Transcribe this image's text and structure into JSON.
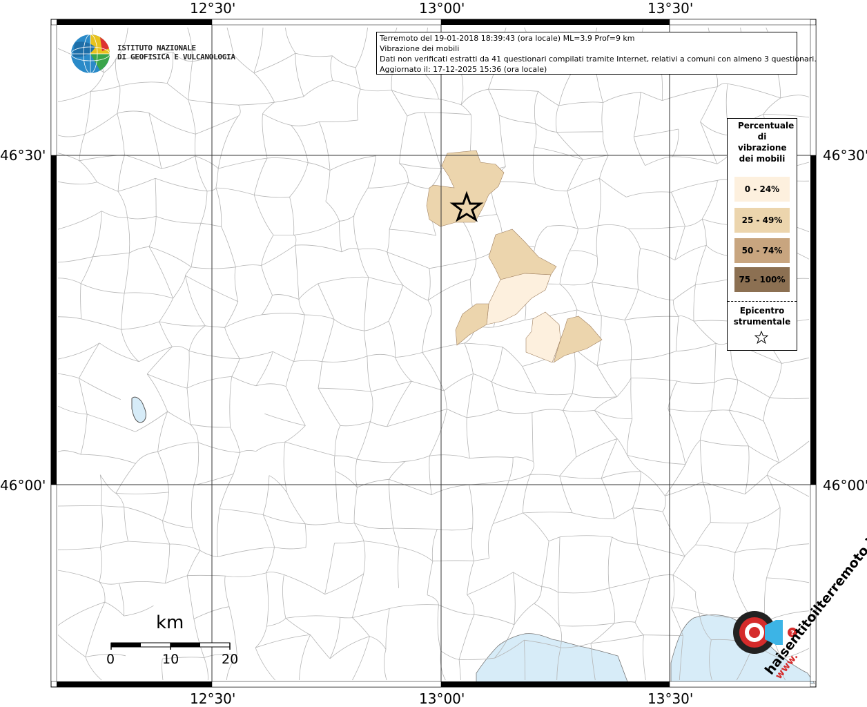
{
  "map": {
    "lon_labels": [
      "12°30'",
      "13°00'",
      "13°30'"
    ],
    "lat_labels": [
      "46°30'",
      "46°00'"
    ],
    "colors": {
      "class_0_24": "#fdf0de",
      "class_25_49": "#ecd5ad",
      "class_50_74": "#c8a57f",
      "class_75_100": "#8c7052",
      "water": "#d7ecf8",
      "border": "#aaaaaa"
    }
  },
  "info": {
    "line1": "Terremoto del 19-01-2018 18:39:43 (ora locale) ML=3.9 Prof=9 km",
    "line2": "Vibrazione dei mobili",
    "line3": "Dati non verificati estratti da 41 questionari compilati tramite Internet, relativi a comuni con almeno 3 questionari.",
    "line4": "Aggiornato il: 17-12-2025 15:36 (ora locale)"
  },
  "legend": {
    "title": "Percentuale di vibrazione dei mobili",
    "classes": [
      "0 - 24%",
      "25 - 49%",
      "50 - 74%",
      "75 - 100%"
    ],
    "epicenter_label": "Epicentro strumentale",
    "epicenter_icon": "star-outline-icon"
  },
  "logo_ingv": {
    "line1": "ISTITUTO NAZIONALE",
    "line2": "DI GEOFISICA E VULCANOLOGIA"
  },
  "logo_hsit": {
    "text": "haisentitoilterremoto.it",
    "www": "www.",
    "icon": "target-speaker-icon"
  },
  "scale": {
    "unit": "km",
    "ticks": [
      "0",
      "10",
      "20"
    ]
  }
}
